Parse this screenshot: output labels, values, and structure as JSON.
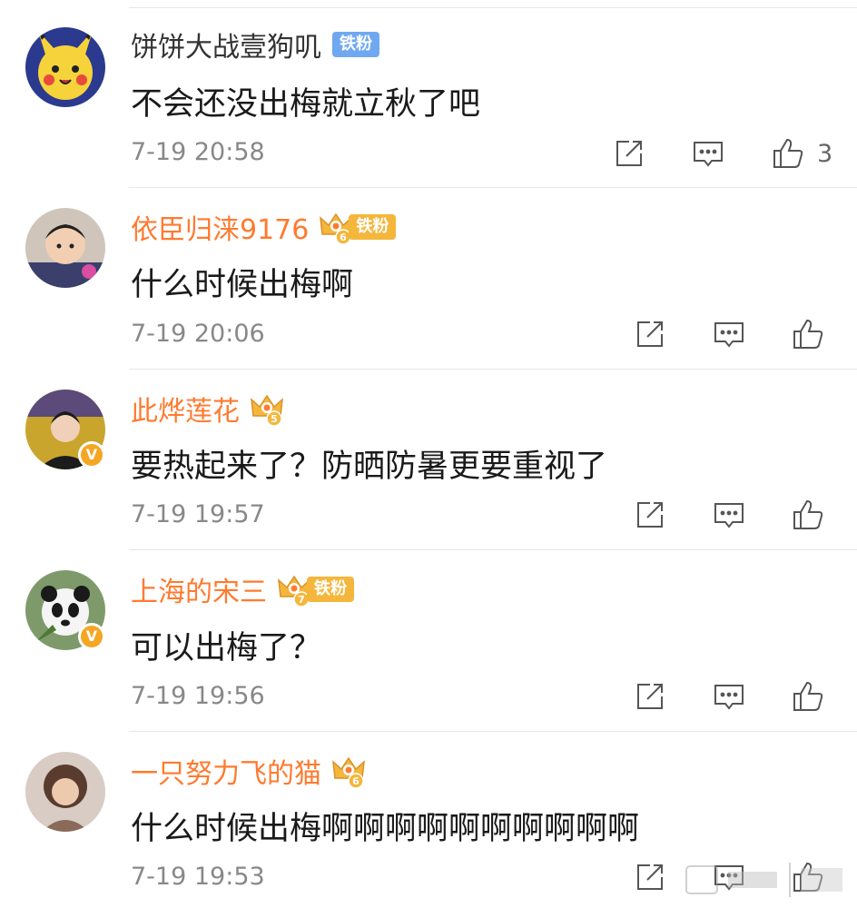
{
  "colors": {
    "vip_name": "#ff7a2f",
    "fan_badge_blue": "#6fa8f0",
    "fan_badge_gold": "#f4b63b",
    "verified": "#f5a623"
  },
  "comments": [
    {
      "username": "饼饼大战壹狗叽",
      "badge": "铁粉",
      "text": "不会还没出梅就立秋了吧",
      "time": "7-19 20:58",
      "likes": "3"
    },
    {
      "username": "依臣归涞9176",
      "badge": "铁粉",
      "crown_level": "6",
      "text": "什么时候出梅啊",
      "time": "7-19 20:06"
    },
    {
      "username": "此烨莲花",
      "crown_level": "5",
      "verified_icon": "V",
      "text": "要热起来了？防晒防暑更要重视了",
      "time": "7-19 19:57"
    },
    {
      "username": "上海的宋三",
      "badge": "铁粉",
      "crown_level": "7",
      "verified_icon": "V",
      "text": "可以出梅了？",
      "time": "7-19 19:56"
    },
    {
      "username": "一只努力飞的猫",
      "crown_level": "6",
      "text": "什么时候出梅啊啊啊啊啊啊啊啊啊啊",
      "time": "7-19 19:53"
    }
  ],
  "icons": {
    "share": "share-icon",
    "comment": "comment-icon",
    "like": "thumbs-up-icon",
    "crown": "crown-icon"
  }
}
